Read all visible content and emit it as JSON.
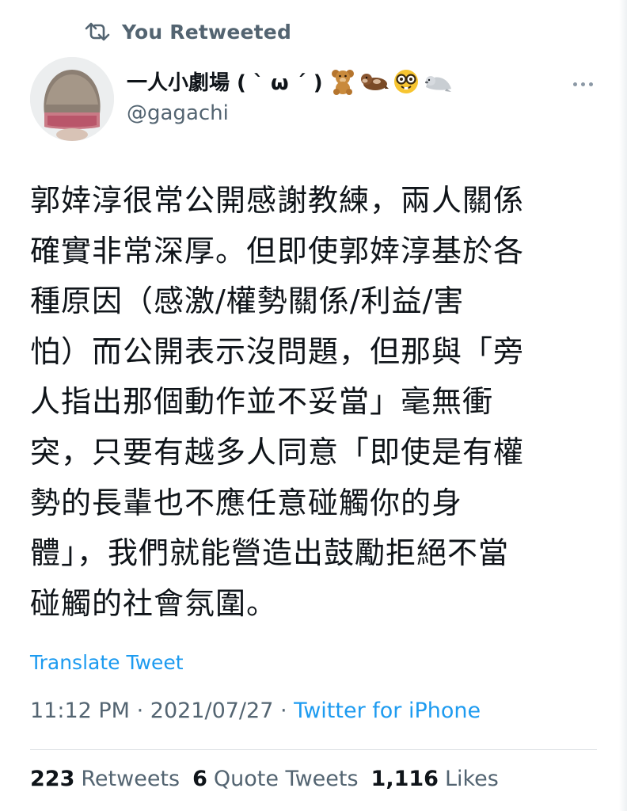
{
  "retweet_banner": {
    "label": "You Retweeted",
    "icon": "retweet-icon"
  },
  "author": {
    "display_name": "一人小劇場 ( ˋ ω ˊ )",
    "emojis": [
      "teddy-bear-emoji",
      "otter-emoji",
      "nerd-face-emoji",
      "seal-emoji"
    ],
    "handle": "@gagachi",
    "avatar": "avatar-photo"
  },
  "tweet": {
    "lines": [
      "郭婞淳很常公開感謝教練，兩人關係",
      "確實非常深厚。但即使郭婞淳基於各",
      "種原因（感激/權勢關係/利益/害",
      "怕）而公開表示沒問題，但那與「旁",
      "人指出那個動作並不妥當」毫無衝",
      "突，只要有越多人同意「即使是有權",
      "勢的長輩也不應任意碰觸你的身",
      "體」，我們就能營造出鼓勵拒絕不當",
      "碰觸的社會氛圍。"
    ],
    "translate_label": "Translate Tweet",
    "time": "11:12 PM",
    "date": "2021/07/27",
    "separator": "·",
    "source": "Twitter for iPhone"
  },
  "stats": {
    "retweets": {
      "count": "223",
      "label": "Retweets"
    },
    "quotes": {
      "count": "6",
      "label": "Quote Tweets"
    },
    "likes": {
      "count": "1,116",
      "label": "Likes"
    }
  },
  "colors": {
    "accent": "#1d9bf0",
    "secondary_text": "#536471",
    "primary_text": "#0f1419",
    "divider": "#dfe3e6"
  }
}
